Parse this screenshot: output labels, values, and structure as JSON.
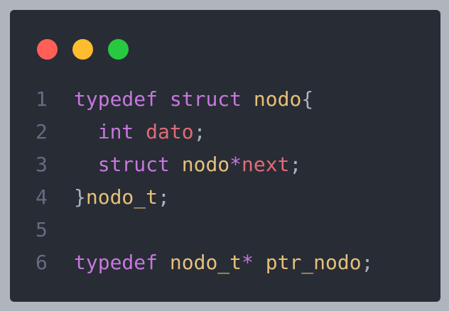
{
  "window": {
    "traffic_lights": [
      "close",
      "minimize",
      "maximize"
    ],
    "colors": {
      "close": "#ff5f57",
      "minimize": "#febc2e",
      "maximize": "#28c840"
    }
  },
  "code": {
    "line_numbers": [
      "1",
      "2",
      "3",
      "4",
      "5",
      "6"
    ],
    "lines": [
      [
        {
          "t": "typedef",
          "c": "kw"
        },
        {
          "t": " ",
          "c": "pn"
        },
        {
          "t": "struct",
          "c": "kw"
        },
        {
          "t": " ",
          "c": "pn"
        },
        {
          "t": "nodo",
          "c": "ty"
        },
        {
          "t": "{",
          "c": "pn"
        }
      ],
      [
        {
          "t": "  ",
          "c": "pn"
        },
        {
          "t": "int",
          "c": "kw"
        },
        {
          "t": " ",
          "c": "pn"
        },
        {
          "t": "dato",
          "c": "id"
        },
        {
          "t": ";",
          "c": "pn"
        }
      ],
      [
        {
          "t": "  ",
          "c": "pn"
        },
        {
          "t": "struct",
          "c": "kw"
        },
        {
          "t": " ",
          "c": "pn"
        },
        {
          "t": "nodo",
          "c": "ty"
        },
        {
          "t": "*",
          "c": "kw"
        },
        {
          "t": "next",
          "c": "id"
        },
        {
          "t": ";",
          "c": "pn"
        }
      ],
      [
        {
          "t": "}",
          "c": "pn"
        },
        {
          "t": "nodo_t",
          "c": "ty"
        },
        {
          "t": ";",
          "c": "pn"
        }
      ],
      [],
      [
        {
          "t": "typedef",
          "c": "kw"
        },
        {
          "t": " ",
          "c": "pn"
        },
        {
          "t": "nodo_t",
          "c": "ty"
        },
        {
          "t": "*",
          "c": "kw"
        },
        {
          "t": " ",
          "c": "pn"
        },
        {
          "t": "ptr_nodo",
          "c": "ty"
        },
        {
          "t": ";",
          "c": "pn"
        }
      ]
    ]
  }
}
